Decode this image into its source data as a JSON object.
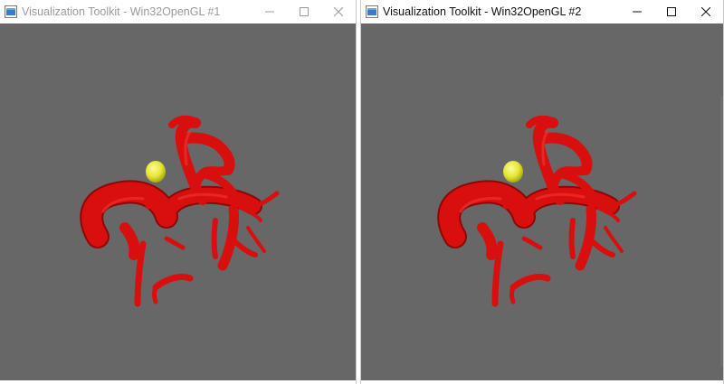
{
  "windows": [
    {
      "title": "Visualization Toolkit - Win32OpenGL #1",
      "active": false,
      "controls": {
        "minimize": "minimize-icon",
        "maximize": "maximize-icon",
        "close": "close-icon"
      },
      "scene": {
        "background": "#676767",
        "vessel_color": "#d90f0f",
        "aneurysm_color": "#e8e83a"
      }
    },
    {
      "title": "Visualization Toolkit - Win32OpenGL #2",
      "active": true,
      "controls": {
        "minimize": "minimize-icon",
        "maximize": "maximize-icon",
        "close": "close-icon"
      },
      "scene": {
        "background": "#676767",
        "vessel_color": "#d90f0f",
        "aneurysm_color": "#e8e83a"
      }
    }
  ]
}
